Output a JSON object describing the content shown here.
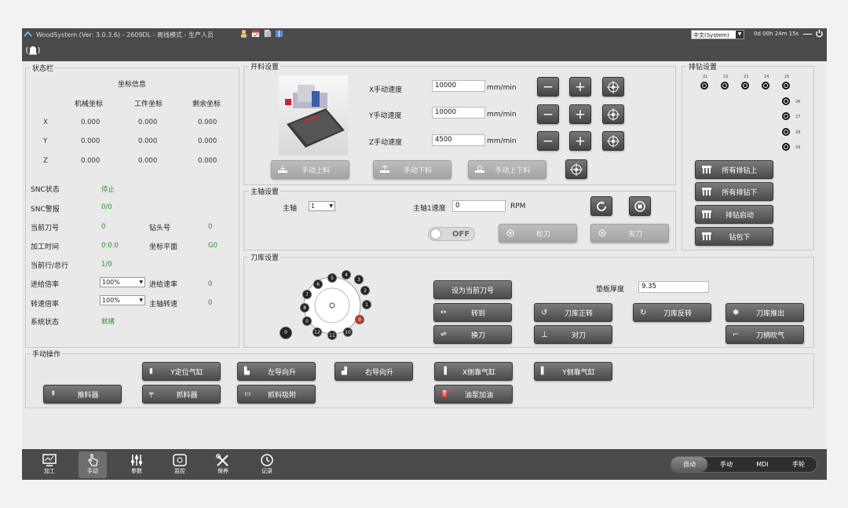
{
  "app": {
    "title": "WoodSystem (Ver: 3.0.3.6) - 2609DL - 离线模式 - 生产人员",
    "language": "中文(System)",
    "runtime": "0d 00h 24m 15s",
    "minimize": "—"
  },
  "status": {
    "title": "状态栏",
    "coord_info": "坐标信息",
    "headers": [
      "机械坐标",
      "工件坐标",
      "剩余坐标"
    ],
    "axes": [
      {
        "axis": "X",
        "values": [
          "0.000",
          "0.000",
          "0.000"
        ]
      },
      {
        "axis": "Y",
        "values": [
          "0.000",
          "0.000",
          "0.000"
        ]
      },
      {
        "axis": "Z",
        "values": [
          "0.000",
          "0.000",
          "0.000"
        ]
      }
    ],
    "snc_state_label": "SNC状态",
    "snc_state": "停止",
    "snc_alarm_label": "SNC警报",
    "snc_alarm": "0/0",
    "tool_label": "当前刀号",
    "tool": "0",
    "drill_head_label": "钻头号",
    "drill_head": "0",
    "time_label": "加工时间",
    "time": "0:0:0",
    "plane_label": "坐标平面",
    "plane": "G0",
    "line_label": "当前行/总行",
    "line": "1/0",
    "feed_rate_label": "进给倍率",
    "feed_rate": "100%",
    "feed_speed_label": "进给速率",
    "feed_speed": "0",
    "spin_rate_label": "转速倍率",
    "spin_rate": "100%",
    "spindle_speed_label": "主轴转速",
    "spindle_speed": "0",
    "sys_state_label": "系统状态",
    "sys_state": "就绪"
  },
  "feed": {
    "title": "开料设置",
    "x_label": "X手动速度",
    "x_value": "10000",
    "y_label": "Y手动速度",
    "y_value": "10000",
    "z_label": "Z手动速度",
    "z_value": "4500",
    "unit": "mm/min",
    "btn_load": "手动上料",
    "btn_unload": "手动下料",
    "btn_loadunload": "手动上下料"
  },
  "spindle": {
    "title": "主轴设置",
    "spindle_label": "主轴",
    "spindle_value": "1",
    "speed_label": "主轴1速度",
    "speed_value": "0",
    "speed_unit": "RPM",
    "toggle": "OFF",
    "btn_loosen": "松刀",
    "btn_clamp": "夹刀"
  },
  "drill": {
    "title": "排钻设置",
    "top_nums": [
      "21",
      "22",
      "23",
      "24",
      "25"
    ],
    "side_nums": [
      "26",
      "27",
      "28",
      "29"
    ],
    "btn_all_up": "所有排钻上",
    "btn_all_down": "所有排钻下",
    "btn_start": "排钻启动",
    "btn_pack_down": "钻包下"
  },
  "toolmag": {
    "title": "刀库设置",
    "slots": [
      "0",
      "1",
      "2",
      "3",
      "4",
      "5",
      "6",
      "7",
      "8",
      "9",
      "10",
      "11",
      "12"
    ],
    "outer_slot": "0",
    "btn_set_current": "设为当前刀号",
    "pad_label": "垫板厚度",
    "pad_value": "9.35",
    "btn_rotate_to": "转到",
    "btn_change": "换刀",
    "btn_mag_fwd": "刀库正转",
    "btn_align": "对刀",
    "btn_mag_rev": "刀库反转",
    "btn_mag_out": "刀库推出",
    "btn_blow": "刀柄吹气"
  },
  "manual": {
    "title": "手动操作",
    "btn_y_locate": "Y定位气缸",
    "btn_left_guide": "左导向升",
    "btn_right_guide": "右导向升",
    "btn_x_side": "X侧靠气缸",
    "btn_y_side": "Y侧靠气缸",
    "btn_push": "推料器",
    "btn_grab": "抓料器",
    "btn_suction": "抓料吸附",
    "btn_oil": "油泵加油"
  },
  "bottom": {
    "nav": [
      "加工",
      "手动",
      "参数",
      "监控",
      "保养",
      "记录"
    ],
    "modes": [
      "自动",
      "手动",
      "MDI",
      "手轮"
    ]
  }
}
